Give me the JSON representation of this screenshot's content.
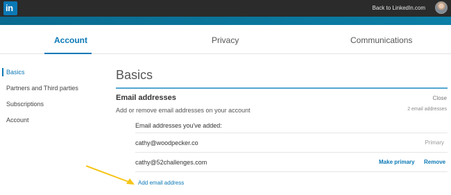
{
  "topbar": {
    "logo_text": "in",
    "back_link": "Back to LinkedIn.com"
  },
  "tabs": [
    {
      "label": "Account",
      "active": true
    },
    {
      "label": "Privacy",
      "active": false
    },
    {
      "label": "Communications",
      "active": false
    }
  ],
  "sidebar": {
    "items": [
      {
        "label": "Basics",
        "active": true
      },
      {
        "label": "Partners and Third parties",
        "active": false
      },
      {
        "label": "Subscriptions",
        "active": false
      },
      {
        "label": "Account",
        "active": false
      }
    ]
  },
  "main": {
    "title": "Basics",
    "section": {
      "title": "Email addresses",
      "close_label": "Close",
      "description": "Add or remove email addresses on your account",
      "count_text": "2 email addresses",
      "added_label": "Email addresses you've added:",
      "emails": [
        {
          "address": "cathy@woodpecker.co",
          "status": "Primary"
        },
        {
          "address": "cathy@52challenges.com",
          "make_primary": "Make primary",
          "remove": "Remove"
        }
      ],
      "add_link": "Add email address"
    }
  },
  "colors": {
    "brand": "#0a78b5",
    "topbar": "#2b2b2b",
    "arrow": "#f5c518"
  },
  "icons": [
    "linkedin-logo-icon",
    "arrow-annotation-icon"
  ]
}
